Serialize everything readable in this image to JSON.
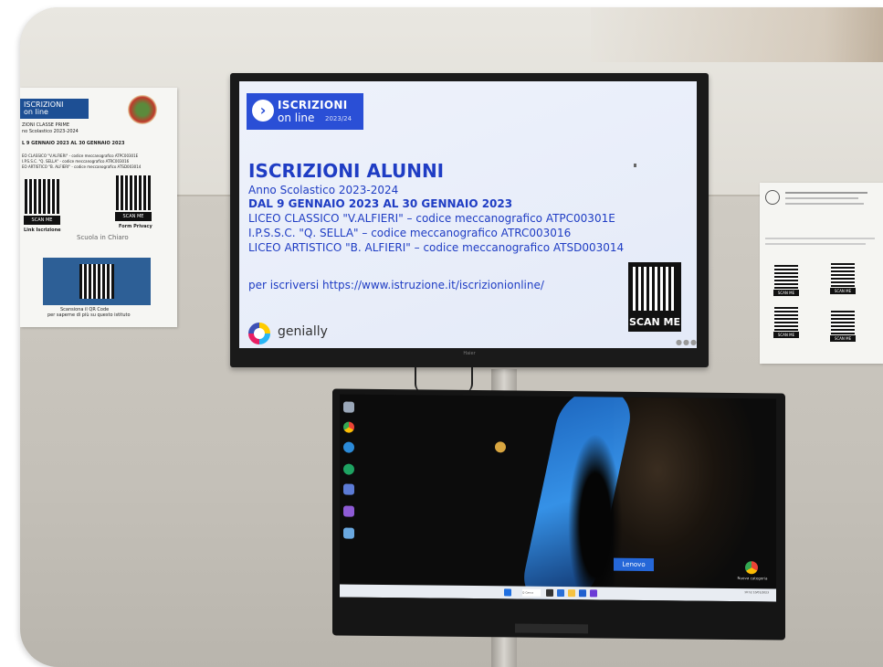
{
  "scene": {
    "description_free": true
  },
  "poster_left": {
    "header_line1": "ISCRIZIONI",
    "header_line2": "on line",
    "sub": "ZIONI CLASSE PRIME",
    "sub2": "no Scolastico 2023-2024",
    "dates": "L 9 GENNAIO 2023 AL 30 GENNAIO 2023",
    "line1": "EO CLASSICO \"V.ALFIERI\" - codice meccanografico ATPC00301E",
    "line2": "I.P.S.S.C. \"Q. SELLA\" - codice meccanografico ATRC003016",
    "line3": "EO ARTISTICO \"B. ALFIERI\" - codice meccanografico ATSD003014",
    "scan_left": "SCAN ME",
    "scan_right": "SCAN ME",
    "caption_left": "Link Iscrizione",
    "caption_right": "Form Privacy",
    "scuola": "Scuola in Chiaro",
    "bottom1": "Scansiona il QR Code",
    "bottom2": "per saperne di più su questo istituto"
  },
  "poster_right": {
    "scan1": "SCAN ME",
    "scan2": "SCAN ME",
    "scan3": "SCAN ME",
    "scan4": "SCAN ME"
  },
  "tv": {
    "badge_line1": "ISCRIZIONI",
    "badge_line2": "on line",
    "badge_year": "2023/24",
    "title": "ISCRIZIONI ALUNNI",
    "year": "Anno Scolastico 2023-2024",
    "dates": "DAL 9 GENNAIO 2023 AL 30 GENNAIO 2023",
    "school1": "LICEO CLASSICO \"V.ALFIERI\" – codice meccanografico ATPC00301E",
    "school2": "I.P.S.S.C. \"Q. SELLA\" – codice meccanografico ATRC003016",
    "school3": "LICEO ARTISTICO \"B. ALFIERI\" – codice meccanografico ATSD003014",
    "link": "per iscriversi https://www.istruzione.it/iscrizionionline/",
    "qr_label": "SCAN ME",
    "genially": "genially",
    "brand": "Haier"
  },
  "monitor": {
    "lenovo": "Lenovo",
    "chrome_label": "Nuova categoria",
    "search": "Q Cerca",
    "clock": "10:12\n10/01/2023"
  },
  "colors": {
    "tv_text": "#1f3dc4",
    "badge": "#2a4fd6",
    "poster_header": "#1d4f94"
  }
}
